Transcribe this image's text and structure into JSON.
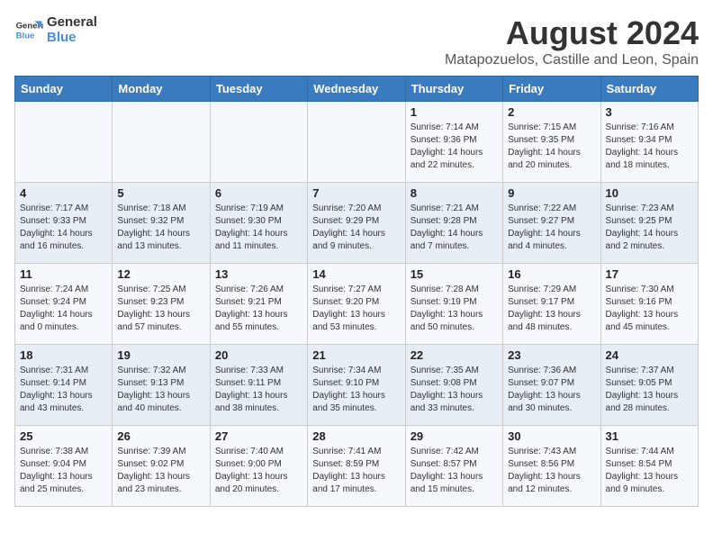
{
  "logo": {
    "line1": "General",
    "line2": "Blue"
  },
  "title": "August 2024",
  "subtitle": "Matapozuelos, Castille and Leon, Spain",
  "headers": [
    "Sunday",
    "Monday",
    "Tuesday",
    "Wednesday",
    "Thursday",
    "Friday",
    "Saturday"
  ],
  "weeks": [
    [
      {
        "day": "",
        "content": ""
      },
      {
        "day": "",
        "content": ""
      },
      {
        "day": "",
        "content": ""
      },
      {
        "day": "",
        "content": ""
      },
      {
        "day": "1",
        "content": "Sunrise: 7:14 AM\nSunset: 9:36 PM\nDaylight: 14 hours\nand 22 minutes."
      },
      {
        "day": "2",
        "content": "Sunrise: 7:15 AM\nSunset: 9:35 PM\nDaylight: 14 hours\nand 20 minutes."
      },
      {
        "day": "3",
        "content": "Sunrise: 7:16 AM\nSunset: 9:34 PM\nDaylight: 14 hours\nand 18 minutes."
      }
    ],
    [
      {
        "day": "4",
        "content": "Sunrise: 7:17 AM\nSunset: 9:33 PM\nDaylight: 14 hours\nand 16 minutes."
      },
      {
        "day": "5",
        "content": "Sunrise: 7:18 AM\nSunset: 9:32 PM\nDaylight: 14 hours\nand 13 minutes."
      },
      {
        "day": "6",
        "content": "Sunrise: 7:19 AM\nSunset: 9:30 PM\nDaylight: 14 hours\nand 11 minutes."
      },
      {
        "day": "7",
        "content": "Sunrise: 7:20 AM\nSunset: 9:29 PM\nDaylight: 14 hours\nand 9 minutes."
      },
      {
        "day": "8",
        "content": "Sunrise: 7:21 AM\nSunset: 9:28 PM\nDaylight: 14 hours\nand 7 minutes."
      },
      {
        "day": "9",
        "content": "Sunrise: 7:22 AM\nSunset: 9:27 PM\nDaylight: 14 hours\nand 4 minutes."
      },
      {
        "day": "10",
        "content": "Sunrise: 7:23 AM\nSunset: 9:25 PM\nDaylight: 14 hours\nand 2 minutes."
      }
    ],
    [
      {
        "day": "11",
        "content": "Sunrise: 7:24 AM\nSunset: 9:24 PM\nDaylight: 14 hours\nand 0 minutes."
      },
      {
        "day": "12",
        "content": "Sunrise: 7:25 AM\nSunset: 9:23 PM\nDaylight: 13 hours\nand 57 minutes."
      },
      {
        "day": "13",
        "content": "Sunrise: 7:26 AM\nSunset: 9:21 PM\nDaylight: 13 hours\nand 55 minutes."
      },
      {
        "day": "14",
        "content": "Sunrise: 7:27 AM\nSunset: 9:20 PM\nDaylight: 13 hours\nand 53 minutes."
      },
      {
        "day": "15",
        "content": "Sunrise: 7:28 AM\nSunset: 9:19 PM\nDaylight: 13 hours\nand 50 minutes."
      },
      {
        "day": "16",
        "content": "Sunrise: 7:29 AM\nSunset: 9:17 PM\nDaylight: 13 hours\nand 48 minutes."
      },
      {
        "day": "17",
        "content": "Sunrise: 7:30 AM\nSunset: 9:16 PM\nDaylight: 13 hours\nand 45 minutes."
      }
    ],
    [
      {
        "day": "18",
        "content": "Sunrise: 7:31 AM\nSunset: 9:14 PM\nDaylight: 13 hours\nand 43 minutes."
      },
      {
        "day": "19",
        "content": "Sunrise: 7:32 AM\nSunset: 9:13 PM\nDaylight: 13 hours\nand 40 minutes."
      },
      {
        "day": "20",
        "content": "Sunrise: 7:33 AM\nSunset: 9:11 PM\nDaylight: 13 hours\nand 38 minutes."
      },
      {
        "day": "21",
        "content": "Sunrise: 7:34 AM\nSunset: 9:10 PM\nDaylight: 13 hours\nand 35 minutes."
      },
      {
        "day": "22",
        "content": "Sunrise: 7:35 AM\nSunset: 9:08 PM\nDaylight: 13 hours\nand 33 minutes."
      },
      {
        "day": "23",
        "content": "Sunrise: 7:36 AM\nSunset: 9:07 PM\nDaylight: 13 hours\nand 30 minutes."
      },
      {
        "day": "24",
        "content": "Sunrise: 7:37 AM\nSunset: 9:05 PM\nDaylight: 13 hours\nand 28 minutes."
      }
    ],
    [
      {
        "day": "25",
        "content": "Sunrise: 7:38 AM\nSunset: 9:04 PM\nDaylight: 13 hours\nand 25 minutes."
      },
      {
        "day": "26",
        "content": "Sunrise: 7:39 AM\nSunset: 9:02 PM\nDaylight: 13 hours\nand 23 minutes."
      },
      {
        "day": "27",
        "content": "Sunrise: 7:40 AM\nSunset: 9:00 PM\nDaylight: 13 hours\nand 20 minutes."
      },
      {
        "day": "28",
        "content": "Sunrise: 7:41 AM\nSunset: 8:59 PM\nDaylight: 13 hours\nand 17 minutes."
      },
      {
        "day": "29",
        "content": "Sunrise: 7:42 AM\nSunset: 8:57 PM\nDaylight: 13 hours\nand 15 minutes."
      },
      {
        "day": "30",
        "content": "Sunrise: 7:43 AM\nSunset: 8:56 PM\nDaylight: 13 hours\nand 12 minutes."
      },
      {
        "day": "31",
        "content": "Sunrise: 7:44 AM\nSunset: 8:54 PM\nDaylight: 13 hours\nand 9 minutes."
      }
    ]
  ]
}
